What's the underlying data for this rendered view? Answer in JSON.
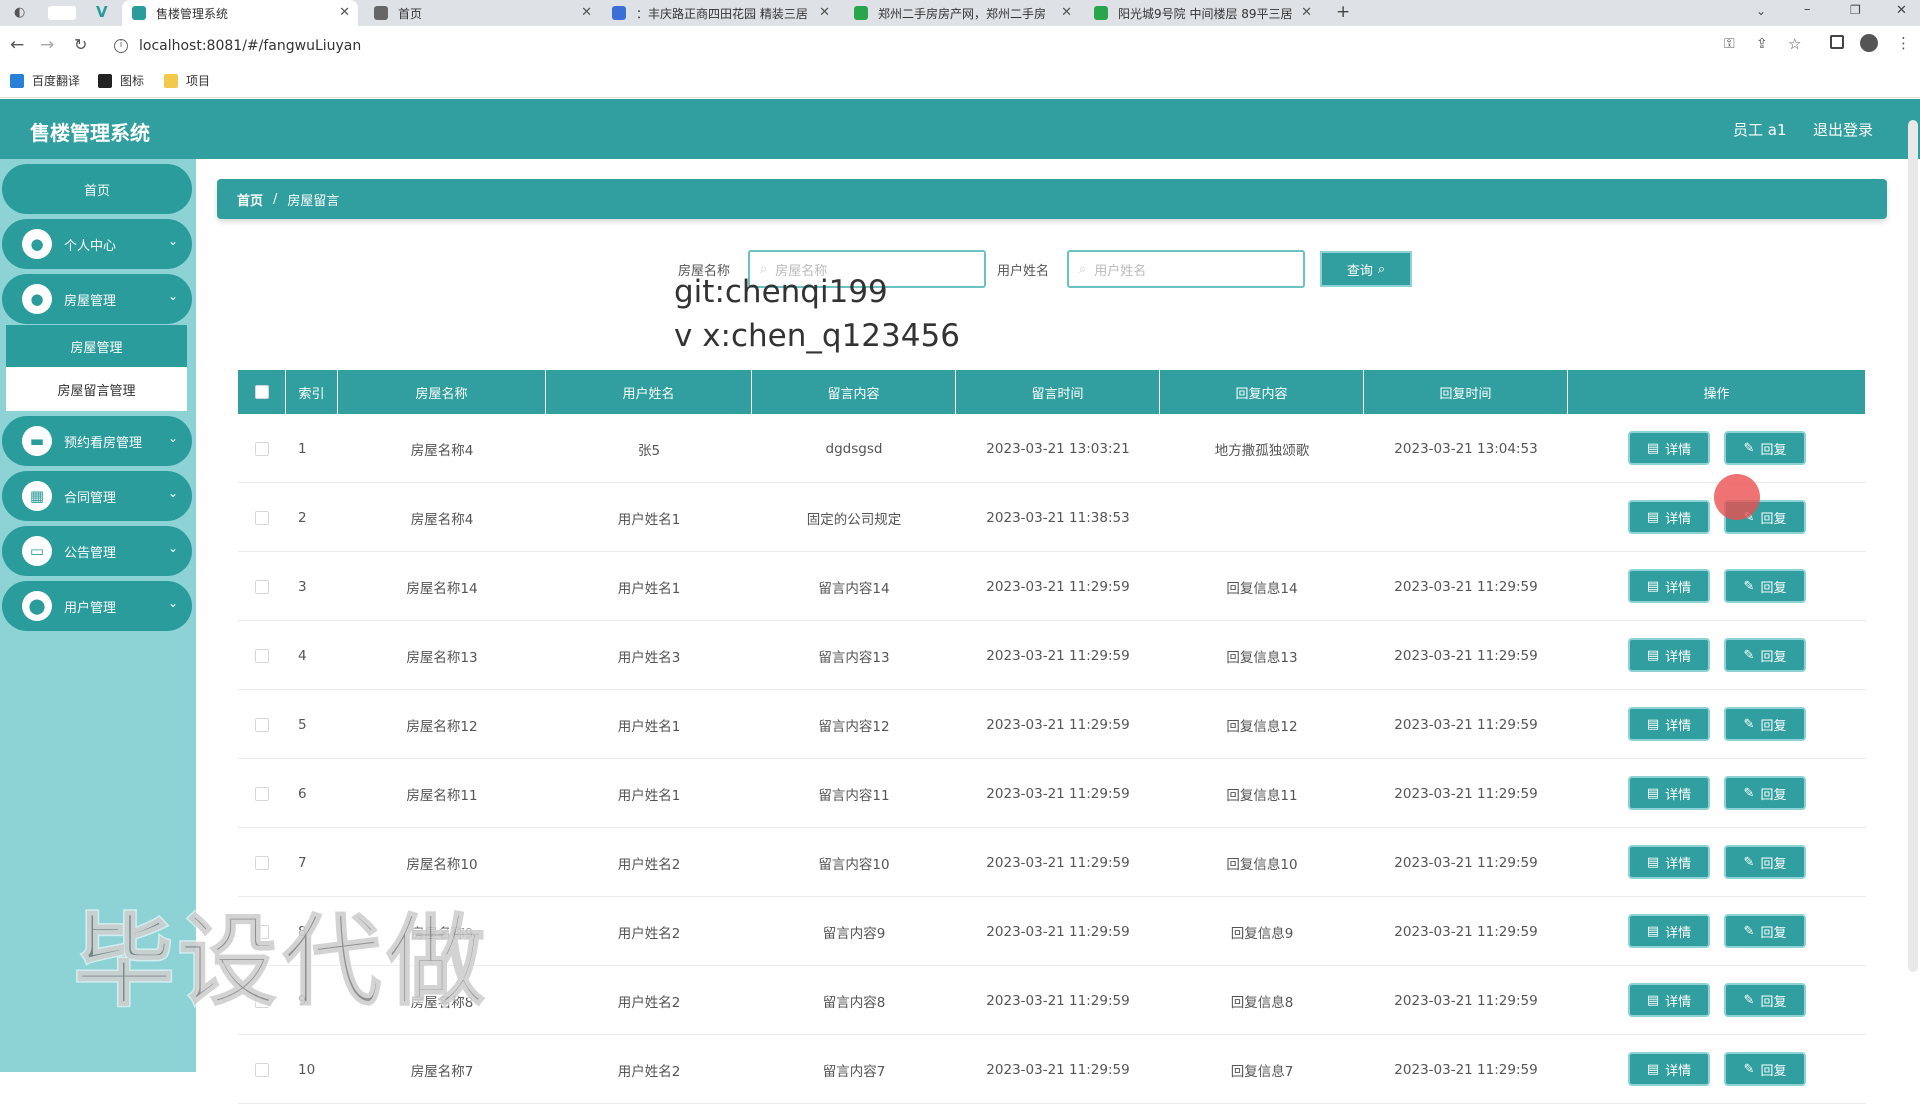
{
  "browser": {
    "tabs": [
      {
        "title": "售楼管理系统",
        "icon_color": "#2a9c9c"
      },
      {
        "title": "首页",
        "icon_color": "#666666"
      },
      {
        "title": "：丰庆路正商四田花园 精装三居",
        "icon_color": "#3b6fd6"
      },
      {
        "title": "郑州二手房房产网，郑州二手房",
        "icon_color": "#2aa54b"
      },
      {
        "title": "阳光城9号院 中间楼层 89平三居",
        "icon_color": "#2aa54b"
      }
    ],
    "address": "localhost:8081/#/fangwuLiuyan",
    "bookmarks": [
      "百度翻译",
      "图标",
      "项目"
    ]
  },
  "header": {
    "title": "售楼管理系统",
    "user": "员工 a1",
    "logout": "退出登录"
  },
  "sidebar": {
    "home": "首页",
    "items": [
      {
        "label": "个人中心",
        "icon": "user-icon"
      },
      {
        "label": "房屋管理",
        "icon": "user-icon"
      },
      {
        "label": "预约看房管理",
        "icon": "briefcase-icon"
      },
      {
        "label": "合同管理",
        "icon": "grid-icon"
      },
      {
        "label": "公告管理",
        "icon": "monitor-icon"
      },
      {
        "label": "用户管理",
        "icon": "location-icon"
      }
    ],
    "submenu": [
      "房屋管理",
      "房屋留言管理"
    ]
  },
  "breadcrumb": {
    "home": "首页",
    "separator": "/",
    "current": "房屋留言"
  },
  "search": {
    "house_label": "房屋名称",
    "house_placeholder": "房屋名称",
    "user_label": "用户姓名",
    "user_placeholder": "用户姓名",
    "button": "查询"
  },
  "overlay": {
    "line1": "git:chenqi199",
    "line2": "v x:chen_q123456",
    "big": "毕设代做"
  },
  "table": {
    "headers": [
      "索引",
      "房屋名称",
      "用户姓名",
      "留言内容",
      "留言时间",
      "回复内容",
      "回复时间",
      "操作"
    ],
    "detail_label": "详情",
    "reply_label": "回复",
    "rows": [
      [
        "1",
        "房屋名称4",
        "张5",
        "dgdsgsd",
        "2023-03-21 13:03:21",
        "地方撒孤独颂歌",
        "2023-03-21 13:04:53"
      ],
      [
        "2",
        "房屋名称4",
        "用户姓名1",
        "固定的公司规定",
        "2023-03-21 11:38:53",
        "",
        ""
      ],
      [
        "3",
        "房屋名称14",
        "用户姓名1",
        "留言内容14",
        "2023-03-21 11:29:59",
        "回复信息14",
        "2023-03-21 11:29:59"
      ],
      [
        "4",
        "房屋名称13",
        "用户姓名3",
        "留言内容13",
        "2023-03-21 11:29:59",
        "回复信息13",
        "2023-03-21 11:29:59"
      ],
      [
        "5",
        "房屋名称12",
        "用户姓名1",
        "留言内容12",
        "2023-03-21 11:29:59",
        "回复信息12",
        "2023-03-21 11:29:59"
      ],
      [
        "6",
        "房屋名称11",
        "用户姓名1",
        "留言内容11",
        "2023-03-21 11:29:59",
        "回复信息11",
        "2023-03-21 11:29:59"
      ],
      [
        "7",
        "房屋名称10",
        "用户姓名2",
        "留言内容10",
        "2023-03-21 11:29:59",
        "回复信息10",
        "2023-03-21 11:29:59"
      ],
      [
        "8",
        "房屋名称9",
        "用户姓名2",
        "留言内容9",
        "2023-03-21 11:29:59",
        "回复信息9",
        "2023-03-21 11:29:59"
      ],
      [
        "9",
        "房屋名称8",
        "用户姓名2",
        "留言内容8",
        "2023-03-21 11:29:59",
        "回复信息8",
        "2023-03-21 11:29:59"
      ],
      [
        "10",
        "房屋名称7",
        "用户姓名2",
        "留言内容7",
        "2023-03-21 11:29:59",
        "回复信息7",
        "2023-03-21 11:29:59"
      ]
    ]
  },
  "colors": {
    "accent": "#319f9f",
    "sidebar": "#8dd3d6",
    "border": "#8dd3d6"
  }
}
